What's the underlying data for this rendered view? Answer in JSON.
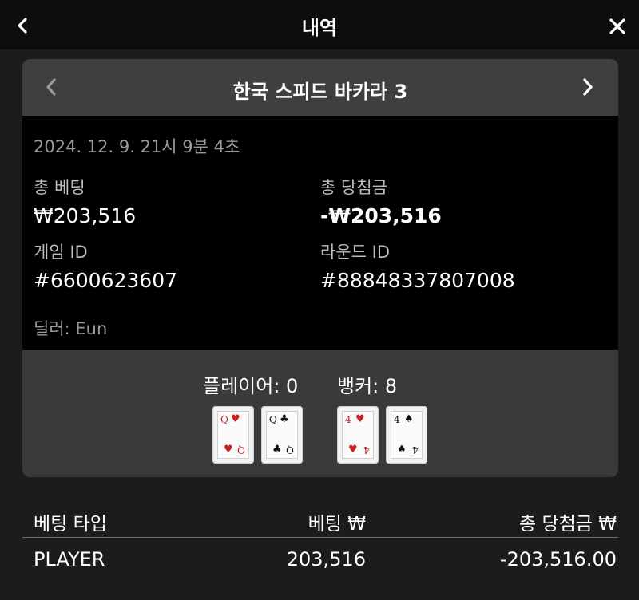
{
  "header": {
    "title": "내역"
  },
  "game": {
    "title": "한국 스피드 바카라 3",
    "datetime": "2024. 12. 9. 21시 9분 4초",
    "total_bet_label": "총 베팅",
    "total_bet_value": "₩203,516",
    "total_win_label": "총 당첨금",
    "total_win_value": "-₩203,516",
    "game_id_label": "게임 ID",
    "game_id_value": "#6600623607",
    "round_id_label": "라운드 ID",
    "round_id_value": "#88848337807008",
    "dealer": "딜러: Eun"
  },
  "result": {
    "player_label": "플레이어: 0",
    "banker_label": "뱅커: 8",
    "player_cards": [
      {
        "rank": "Q",
        "suit": "♥",
        "color": "#c82020"
      },
      {
        "rank": "Q",
        "suit": "♣",
        "color": "#111111"
      }
    ],
    "banker_cards": [
      {
        "rank": "4",
        "suit": "♥",
        "color": "#c82020"
      },
      {
        "rank": "4",
        "suit": "♠",
        "color": "#111111"
      }
    ]
  },
  "table": {
    "headers": [
      "베팅 타입",
      "베팅 ₩",
      "총 당첨금 ₩"
    ],
    "rows": [
      [
        "PLAYER",
        "203,516",
        "-203,516.00"
      ]
    ]
  },
  "icons": {
    "back": "chevron-left-icon",
    "close": "close-icon",
    "prev": "chevron-left-icon",
    "next": "chevron-right-icon"
  }
}
